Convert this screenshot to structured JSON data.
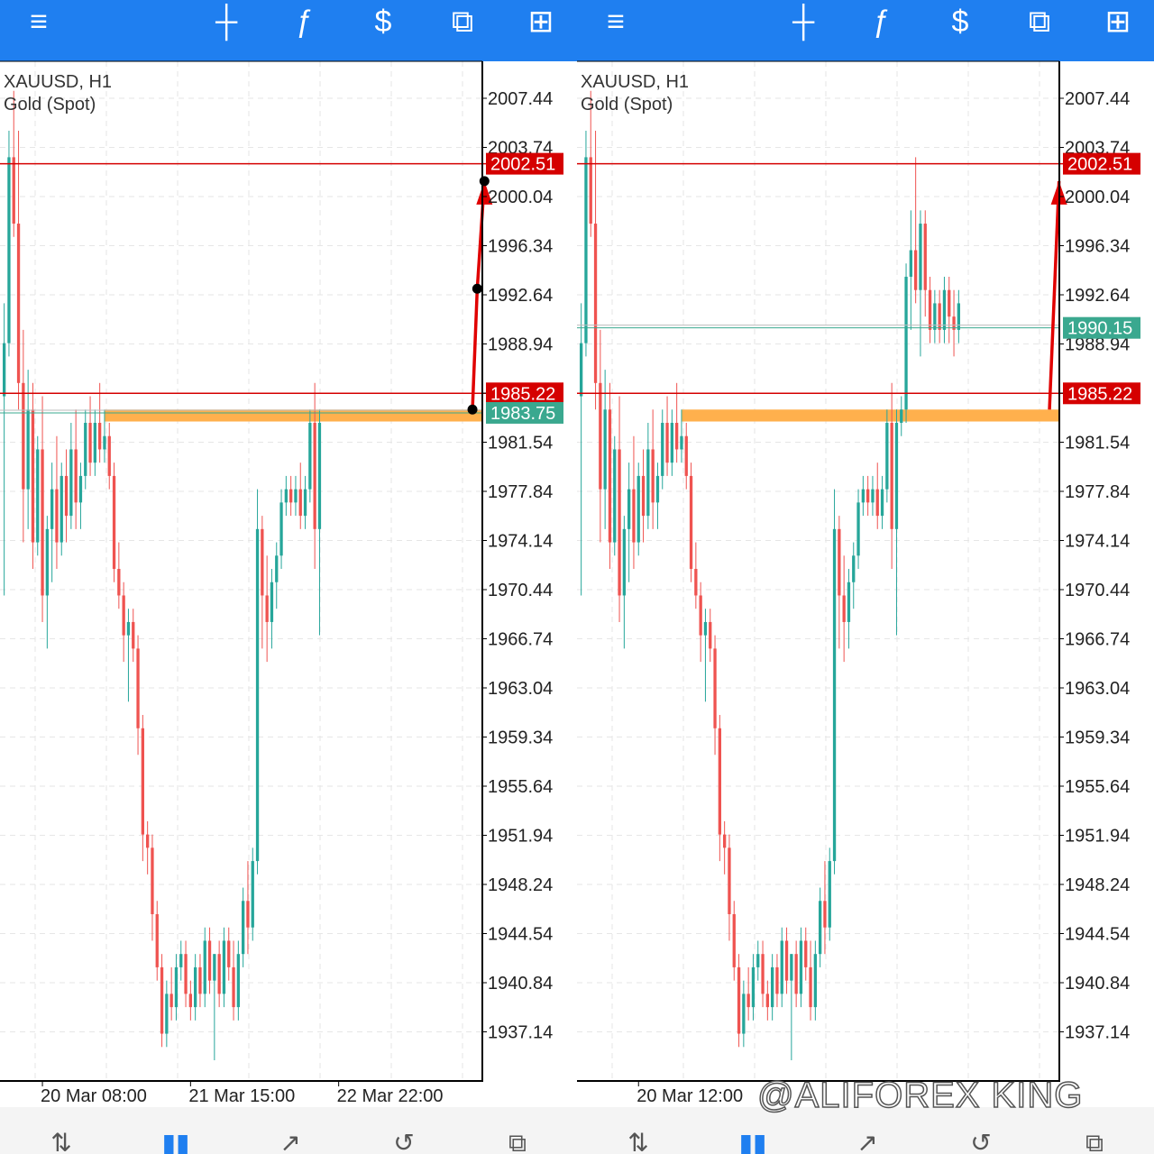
{
  "toolbar": {
    "icons": [
      "menu-icon",
      "crosshair-icon",
      "indicators-icon",
      "new-order-icon",
      "windows-icon",
      "add-object-icon"
    ],
    "glyphs": [
      "≡",
      "┼",
      "ƒ",
      "$",
      "⧉",
      "⊞"
    ]
  },
  "bottom_nav": {
    "icons": [
      "trade-icon",
      "chart-icon",
      "quotes-icon",
      "history-icon",
      "messages-icon"
    ],
    "glyphs": [
      "⇅",
      "▮▮",
      "↗",
      "↺",
      "⧉"
    ],
    "active_index": 1
  },
  "colors": {
    "toolbar_bg": "#1f7ff0",
    "bull": "#26a69a",
    "bear": "#ef5350",
    "level_line": "#d50000",
    "ask_line": "#3aa88f",
    "zone": "#ffb04d",
    "arrow": "#e00000",
    "grid": "#e6e6e6"
  },
  "watermark": "@ALIFOREX KING",
  "charts": [
    {
      "symbol": "XAUUSD, H1",
      "description": "Gold (Spot)",
      "chart_data": {
        "type": "candlestick",
        "price_axis": {
          "labels": [
            "2007.44",
            "2003.74",
            "2000.04",
            "1996.34",
            "1992.64",
            "1988.94",
            "1985.22",
            "1981.54",
            "1977.84",
            "1974.14",
            "1970.44",
            "1966.74",
            "1963.04",
            "1959.34",
            "1955.64",
            "1951.94",
            "1948.24",
            "1944.54",
            "1940.84",
            "1937.14"
          ],
          "top_value": 2007.44,
          "step": 3.7
        },
        "time_labels": [
          "20 Mar 08:00",
          "21 Mar 15:00",
          "22 Mar 22:00"
        ],
        "time_label_bar_index": [
          8,
          39,
          70
        ],
        "horizontal_lines": [
          {
            "price": 2002.51,
            "label": "2002.51",
            "type": "resistance"
          },
          {
            "price": 1985.22,
            "label": "1985.22",
            "type": "support"
          }
        ],
        "current_price": {
          "price": 1983.75,
          "label": "1983.75"
        },
        "zone": {
          "from": 1984.0,
          "to": 1983.1
        },
        "projection": [
          {
            "bar": 98.5,
            "price": 1984.0
          },
          {
            "bar": 99.5,
            "price": 1993.1
          },
          {
            "bar": 101,
            "price": 2001.2
          }
        ],
        "projection_points": true,
        "candles": [
          [
            1985.0,
            1992.0,
            1970.0,
            1989.0
          ],
          [
            1989.0,
            2005.0,
            1988.0,
            2003.0
          ],
          [
            2003.0,
            2008.0,
            1997.0,
            1998.0
          ],
          [
            1998.0,
            2005.0,
            1984.0,
            1986.0
          ],
          [
            1986.0,
            1990.0,
            1974.0,
            1978.0
          ],
          [
            1978.0,
            1987.0,
            1975.0,
            1984.0
          ],
          [
            1984.0,
            1986.0,
            1972.0,
            1974.0
          ],
          [
            1974.0,
            1982.0,
            1973.0,
            1981.0
          ],
          [
            1981.0,
            1985.0,
            1968.0,
            1970.0
          ],
          [
            1970.0,
            1976.0,
            1966.0,
            1975.0
          ],
          [
            1975.0,
            1980.0,
            1971.0,
            1978.0
          ],
          [
            1978.0,
            1982.0,
            1972.0,
            1974.0
          ],
          [
            1974.0,
            1980.0,
            1973.0,
            1979.0
          ],
          [
            1979.0,
            1981.0,
            1974.0,
            1976.0
          ],
          [
            1976.0,
            1983.0,
            1975.0,
            1981.0
          ],
          [
            1981.0,
            1984.0,
            1975.0,
            1977.0
          ],
          [
            1977.0,
            1980.0,
            1975.0,
            1979.0
          ],
          [
            1979.0,
            1984.0,
            1978.0,
            1983.0
          ],
          [
            1983.0,
            1985.0,
            1979.0,
            1980.0
          ],
          [
            1980.0,
            1984.0,
            1979.0,
            1983.0
          ],
          [
            1983.0,
            1986.0,
            1980.0,
            1981.0
          ],
          [
            1981.0,
            1984.0,
            1980.0,
            1982.0
          ],
          [
            1982.0,
            1983.0,
            1978.0,
            1979.0
          ],
          [
            1979.0,
            1980.0,
            1971.0,
            1972.0
          ],
          [
            1972.0,
            1974.0,
            1969.0,
            1970.0
          ],
          [
            1970.0,
            1971.0,
            1965.0,
            1967.0
          ],
          [
            1967.0,
            1969.0,
            1962.0,
            1968.0
          ],
          [
            1968.0,
            1969.0,
            1965.0,
            1966.0
          ],
          [
            1966.0,
            1967.0,
            1958.0,
            1960.0
          ],
          [
            1960.0,
            1961.0,
            1950.0,
            1952.0
          ],
          [
            1952.0,
            1953.0,
            1949.0,
            1951.0
          ],
          [
            1951.0,
            1952.0,
            1944.0,
            1946.0
          ],
          [
            1946.0,
            1947.0,
            1941.0,
            1942.0
          ],
          [
            1942.0,
            1943.0,
            1936.0,
            1937.0
          ],
          [
            1937.0,
            1941.0,
            1936.0,
            1940.0
          ],
          [
            1940.0,
            1942.0,
            1938.0,
            1939.0
          ],
          [
            1939.0,
            1943.0,
            1938.0,
            1942.0
          ],
          [
            1942.0,
            1944.0,
            1941.0,
            1943.0
          ],
          [
            1943.0,
            1944.0,
            1939.0,
            1940.0
          ],
          [
            1940.0,
            1941.0,
            1938.0,
            1939.0
          ],
          [
            1939.0,
            1943.0,
            1938.0,
            1942.0
          ],
          [
            1942.0,
            1943.0,
            1939.0,
            1940.0
          ],
          [
            1940.0,
            1945.0,
            1939.0,
            1944.0
          ],
          [
            1944.0,
            1945.0,
            1940.0,
            1941.0
          ],
          [
            1941.0,
            1943.0,
            1935.0,
            1943.0
          ],
          [
            1943.0,
            1944.0,
            1939.0,
            1940.0
          ],
          [
            1940.0,
            1945.0,
            1939.0,
            1944.0
          ],
          [
            1944.0,
            1945.0,
            1941.0,
            1942.0
          ],
          [
            1942.0,
            1944.0,
            1938.0,
            1939.0
          ],
          [
            1939.0,
            1944.0,
            1938.0,
            1943.0
          ],
          [
            1943.0,
            1948.0,
            1942.0,
            1947.0
          ],
          [
            1947.0,
            1950.0,
            1943.0,
            1945.0
          ],
          [
            1945.0,
            1951.0,
            1944.0,
            1950.0
          ],
          [
            1950.0,
            1978.0,
            1949.0,
            1975.0
          ],
          [
            1975.0,
            1976.0,
            1966.0,
            1970.0
          ],
          [
            1970.0,
            1973.0,
            1965.0,
            1968.0
          ],
          [
            1968.0,
            1972.0,
            1966.0,
            1971.0
          ],
          [
            1971.0,
            1974.0,
            1969.0,
            1973.0
          ],
          [
            1973.0,
            1978.0,
            1972.0,
            1977.0
          ],
          [
            1977.0,
            1979.0,
            1976.0,
            1978.0
          ],
          [
            1978.0,
            1979.0,
            1976.0,
            1977.0
          ],
          [
            1977.0,
            1979.0,
            1976.0,
            1978.0
          ],
          [
            1978.0,
            1980.0,
            1975.0,
            1976.0
          ],
          [
            1976.0,
            1979.0,
            1975.0,
            1978.0
          ],
          [
            1978.0,
            1984.0,
            1977.0,
            1983.0
          ],
          [
            1983.0,
            1986.0,
            1972.0,
            1975.0
          ],
          [
            1975.0,
            1984.0,
            1967.0,
            1983.0
          ]
        ]
      }
    },
    {
      "symbol": "XAUUSD, H1",
      "description": "Gold (Spot)",
      "chart_data": {
        "type": "candlestick",
        "price_axis": {
          "labels": [
            "2007.44",
            "2003.74",
            "2000.04",
            "1996.34",
            "1992.64",
            "1988.94",
            "1985.22",
            "1981.54",
            "1977.84",
            "1974.14",
            "1970.44",
            "1966.74",
            "1963.04",
            "1959.34",
            "1955.64",
            "1951.94",
            "1948.24",
            "1944.54",
            "1940.84",
            "1937.14"
          ],
          "top_value": 2007.44,
          "step": 3.7
        },
        "time_labels": [
          "20 Mar 12:00"
        ],
        "time_label_bar_index": [
          12
        ],
        "horizontal_lines": [
          {
            "price": 2002.51,
            "label": "2002.51",
            "type": "resistance"
          },
          {
            "price": 1985.22,
            "label": "1985.22",
            "type": "support"
          }
        ],
        "current_price": {
          "price": 1990.15,
          "label": "1990.15"
        },
        "zone": {
          "from": 1984.0,
          "to": 1983.1
        },
        "projection": [
          {
            "bar": 98.5,
            "price": 1984.0
          },
          {
            "bar": 100.5,
            "price": 2001.2
          }
        ],
        "projection_points": false,
        "candles": [
          [
            1985.0,
            1992.0,
            1970.0,
            1989.0
          ],
          [
            1989.0,
            2005.0,
            1988.0,
            2003.0
          ],
          [
            2003.0,
            2008.0,
            1997.0,
            1998.0
          ],
          [
            1998.0,
            2005.0,
            1984.0,
            1986.0
          ],
          [
            1986.0,
            1990.0,
            1974.0,
            1978.0
          ],
          [
            1978.0,
            1987.0,
            1975.0,
            1984.0
          ],
          [
            1984.0,
            1986.0,
            1972.0,
            1974.0
          ],
          [
            1974.0,
            1982.0,
            1973.0,
            1981.0
          ],
          [
            1981.0,
            1985.0,
            1968.0,
            1970.0
          ],
          [
            1970.0,
            1976.0,
            1966.0,
            1975.0
          ],
          [
            1975.0,
            1980.0,
            1971.0,
            1978.0
          ],
          [
            1978.0,
            1982.0,
            1972.0,
            1974.0
          ],
          [
            1974.0,
            1980.0,
            1973.0,
            1979.0
          ],
          [
            1979.0,
            1981.0,
            1974.0,
            1976.0
          ],
          [
            1976.0,
            1983.0,
            1975.0,
            1981.0
          ],
          [
            1981.0,
            1984.0,
            1975.0,
            1977.0
          ],
          [
            1977.0,
            1980.0,
            1975.0,
            1979.0
          ],
          [
            1979.0,
            1984.0,
            1978.0,
            1983.0
          ],
          [
            1983.0,
            1985.0,
            1979.0,
            1980.0
          ],
          [
            1980.0,
            1984.0,
            1979.0,
            1983.0
          ],
          [
            1983.0,
            1986.0,
            1980.0,
            1981.0
          ],
          [
            1981.0,
            1984.0,
            1980.0,
            1982.0
          ],
          [
            1982.0,
            1983.0,
            1978.0,
            1979.0
          ],
          [
            1979.0,
            1980.0,
            1971.0,
            1972.0
          ],
          [
            1972.0,
            1974.0,
            1969.0,
            1970.0
          ],
          [
            1970.0,
            1971.0,
            1965.0,
            1967.0
          ],
          [
            1967.0,
            1969.0,
            1962.0,
            1968.0
          ],
          [
            1968.0,
            1969.0,
            1965.0,
            1966.0
          ],
          [
            1966.0,
            1967.0,
            1958.0,
            1960.0
          ],
          [
            1960.0,
            1961.0,
            1950.0,
            1952.0
          ],
          [
            1952.0,
            1953.0,
            1949.0,
            1951.0
          ],
          [
            1951.0,
            1952.0,
            1944.0,
            1946.0
          ],
          [
            1946.0,
            1947.0,
            1941.0,
            1942.0
          ],
          [
            1942.0,
            1943.0,
            1936.0,
            1937.0
          ],
          [
            1937.0,
            1941.0,
            1936.0,
            1940.0
          ],
          [
            1940.0,
            1942.0,
            1938.0,
            1939.0
          ],
          [
            1939.0,
            1943.0,
            1938.0,
            1942.0
          ],
          [
            1942.0,
            1944.0,
            1941.0,
            1943.0
          ],
          [
            1943.0,
            1944.0,
            1939.0,
            1940.0
          ],
          [
            1940.0,
            1941.0,
            1938.0,
            1939.0
          ],
          [
            1939.0,
            1943.0,
            1938.0,
            1942.0
          ],
          [
            1942.0,
            1943.0,
            1939.0,
            1940.0
          ],
          [
            1940.0,
            1945.0,
            1939.0,
            1944.0
          ],
          [
            1944.0,
            1945.0,
            1940.0,
            1941.0
          ],
          [
            1941.0,
            1943.0,
            1935.0,
            1943.0
          ],
          [
            1943.0,
            1944.0,
            1939.0,
            1940.0
          ],
          [
            1940.0,
            1945.0,
            1939.0,
            1944.0
          ],
          [
            1944.0,
            1945.0,
            1941.0,
            1942.0
          ],
          [
            1942.0,
            1944.0,
            1938.0,
            1939.0
          ],
          [
            1939.0,
            1944.0,
            1938.0,
            1943.0
          ],
          [
            1943.0,
            1948.0,
            1942.0,
            1947.0
          ],
          [
            1947.0,
            1950.0,
            1943.0,
            1945.0
          ],
          [
            1945.0,
            1951.0,
            1944.0,
            1950.0
          ],
          [
            1950.0,
            1978.0,
            1949.0,
            1975.0
          ],
          [
            1975.0,
            1976.0,
            1966.0,
            1970.0
          ],
          [
            1970.0,
            1973.0,
            1965.0,
            1968.0
          ],
          [
            1968.0,
            1972.0,
            1966.0,
            1971.0
          ],
          [
            1971.0,
            1974.0,
            1969.0,
            1973.0
          ],
          [
            1973.0,
            1978.0,
            1972.0,
            1977.0
          ],
          [
            1977.0,
            1979.0,
            1976.0,
            1978.0
          ],
          [
            1978.0,
            1979.0,
            1976.0,
            1977.0
          ],
          [
            1977.0,
            1979.0,
            1976.0,
            1978.0
          ],
          [
            1978.0,
            1980.0,
            1975.0,
            1976.0
          ],
          [
            1976.0,
            1979.0,
            1975.0,
            1978.0
          ],
          [
            1978.0,
            1984.0,
            1977.0,
            1983.0
          ],
          [
            1983.0,
            1986.0,
            1972.0,
            1975.0
          ],
          [
            1975.0,
            1984.0,
            1967.0,
            1983.0
          ],
          [
            1983.0,
            1985.0,
            1982.0,
            1984.0
          ],
          [
            1984.0,
            1995.0,
            1983.0,
            1994.0
          ],
          [
            1994.0,
            1999.0,
            1990.0,
            1996.0
          ],
          [
            1996.0,
            2003.0,
            1992.0,
            1993.0
          ],
          [
            1993.0,
            1999.0,
            1988.0,
            1998.0
          ],
          [
            1998.0,
            1999.0,
            1991.0,
            1993.0
          ],
          [
            1993.0,
            1994.0,
            1989.0,
            1990.0
          ],
          [
            1990.0,
            1993.0,
            1989.0,
            1992.0
          ],
          [
            1992.0,
            1993.0,
            1989.0,
            1990.0
          ],
          [
            1990.0,
            1994.0,
            1989.0,
            1993.0
          ],
          [
            1993.0,
            1994.0,
            1989.0,
            1991.0
          ],
          [
            1991.0,
            1993.0,
            1988.0,
            1990.0
          ],
          [
            1990.0,
            1993.0,
            1989.0,
            1992.0
          ]
        ]
      }
    }
  ]
}
